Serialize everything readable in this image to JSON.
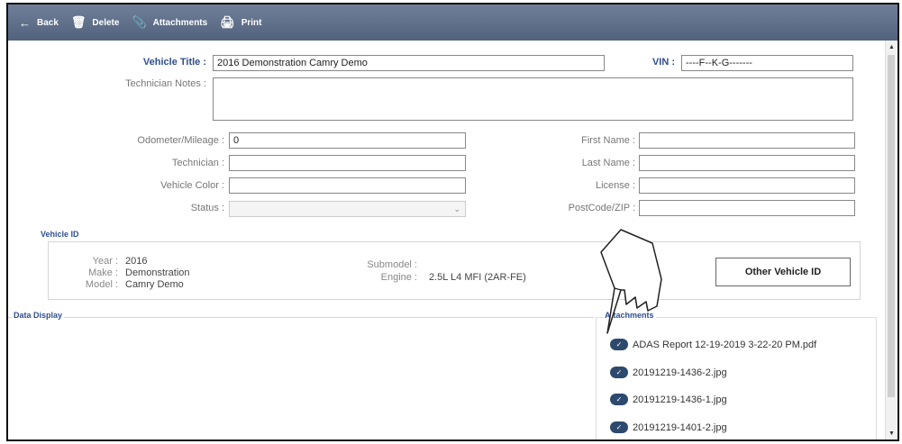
{
  "toolbar": {
    "back_label": "Back",
    "delete_label": "Delete",
    "attachments_label": "Attachments",
    "print_label": "Print"
  },
  "vehicle": {
    "title_label": "Vehicle Title :",
    "title_value": "2016 Demonstration Camry Demo",
    "vin_label": "VIN :",
    "vin_value": "----F--K-G-------",
    "notes_label": "Technician Notes :",
    "notes_value": ""
  },
  "form_left": {
    "odometer_label": "Odometer/Mileage :",
    "odometer_value": "0",
    "technician_label": "Technician :",
    "technician_value": "",
    "color_label": "Vehicle Color :",
    "color_value": "",
    "status_label": "Status :",
    "status_value": ""
  },
  "form_right": {
    "first_name_label": "First Name :",
    "first_name_value": "",
    "last_name_label": "Last Name :",
    "last_name_value": "",
    "license_label": "License :",
    "license_value": "",
    "postcode_label": "PostCode/ZIP :",
    "postcode_value": ""
  },
  "vehicle_id": {
    "section_title": "Vehicle ID",
    "year_label": "Year :",
    "year_value": "2016",
    "make_label": "Make :",
    "make_value": "Demonstration",
    "model_label": "Model :",
    "model_value": "Camry Demo",
    "submodel_label": "Submodel :",
    "submodel_value": "",
    "engine_label": "Engine :",
    "engine_value": "2.5L L4 MFI (2AR-FE)",
    "other_button": "Other Vehicle ID"
  },
  "data_display": {
    "title": "Data Display"
  },
  "attachments": {
    "title": "Attachments",
    "items": [
      "ADAS Report 12-19-2019 3-22-20 PM.pdf",
      "20191219-1436-2.jpg",
      "20191219-1436-1.jpg",
      "20191219-1401-2.jpg"
    ]
  }
}
